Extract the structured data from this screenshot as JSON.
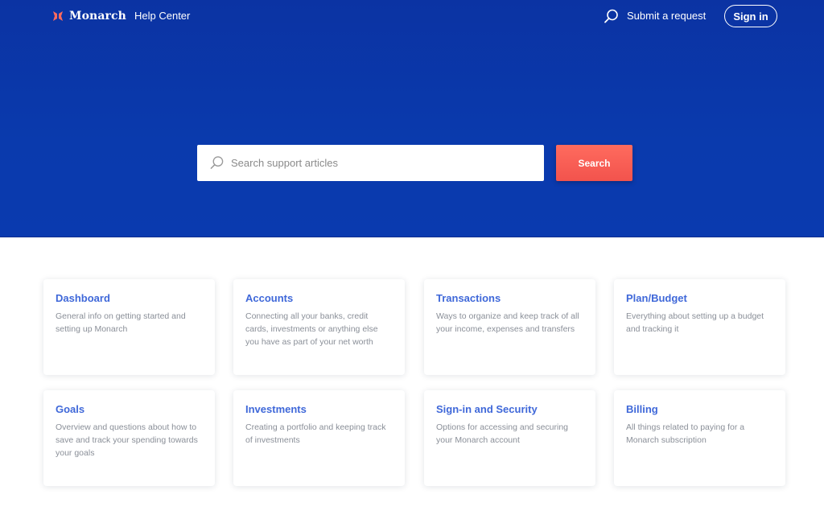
{
  "header": {
    "brand": "Monarch",
    "help_center": "Help Center",
    "submit_request": "Submit a request",
    "sign_in": "Sign in"
  },
  "search": {
    "placeholder": "Search support articles",
    "button_label": "Search"
  },
  "colors": {
    "hero_blue": "#0a3aad",
    "search_button": "#f2534d",
    "card_title": "#3f68d9",
    "brand_mark": "#ff6b5e"
  },
  "categories": [
    {
      "title": "Dashboard",
      "description": "General info on getting started and setting up Monarch"
    },
    {
      "title": "Accounts",
      "description": "Connecting all your banks, credit cards, investments or anything else you have as part of your net worth"
    },
    {
      "title": "Transactions",
      "description": "Ways to organize and keep track of all your income, expenses and transfers"
    },
    {
      "title": "Plan/Budget",
      "description": "Everything about setting up a budget and tracking it"
    },
    {
      "title": "Goals",
      "description": "Overview and questions about how to save and track your spending towards your goals"
    },
    {
      "title": "Investments",
      "description": "Creating a portfolio and keeping track of investments"
    },
    {
      "title": "Sign-in and Security",
      "description": "Options for accessing and securing your Monarch account"
    },
    {
      "title": "Billing",
      "description": "All things related to paying for a Monarch subscription"
    }
  ]
}
